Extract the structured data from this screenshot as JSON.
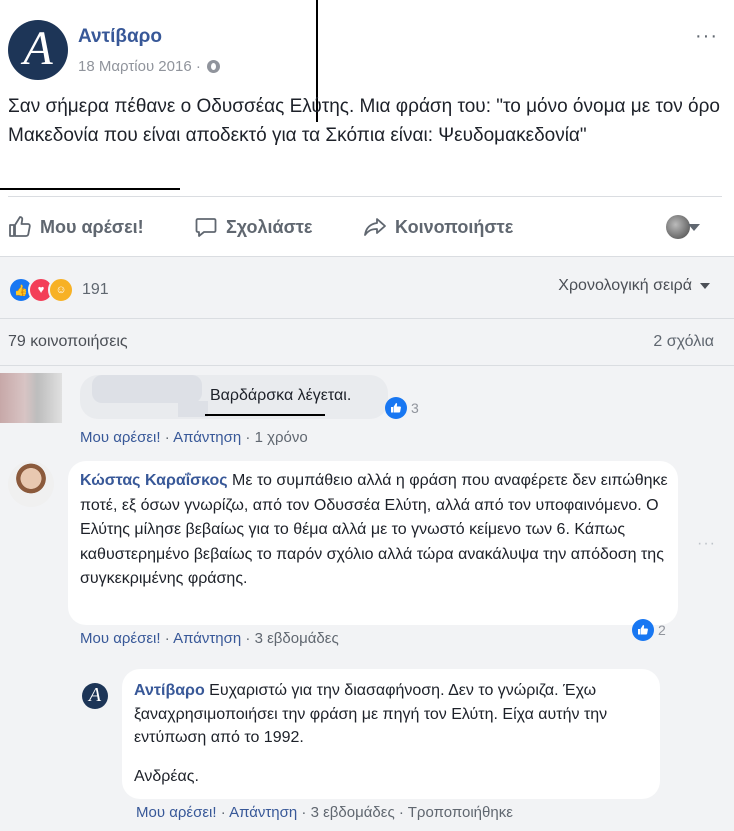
{
  "post": {
    "page_name": "Αντίβαρο",
    "avatar_letter": "A",
    "date": "18 Μαρτίου 2016 ·",
    "more": "···",
    "text": "Σαν σήμερα πέθανε ο Οδυσσέας Ελύτης. Μια φράση του: \"το μόνο όνομα με τον όρο Μακεδονία που είναι αποδεκτό για τα Σκόπια είναι: Ψευδομακεδονία\""
  },
  "actions": {
    "like": "Μου αρέσει!",
    "comment": "Σχολιάστε",
    "share": "Κοινοποιήστε"
  },
  "stats": {
    "reactions_count": "191",
    "sort_label": "Χρονολογική σειρά",
    "shares": "79 κοινοποιήσεις",
    "comments": "2 σχόλια"
  },
  "comments": [
    {
      "text": "Βαρδάρσκα λέγεται.",
      "likes": "3",
      "like_label": "Μου αρέσει!",
      "reply_label": "Απάντηση",
      "time": "1 χρόνο"
    },
    {
      "author": "Κώστας Καραΐσκος",
      "text": "Με το συμπάθειο αλλά η φράση που αναφέρετε δεν ειπώθηκε ποτέ, εξ όσων γνωρίζω, από τον Οδυσσέα Ελύτη, αλλά από τον υποφαινόμενο. Ο Ελύτης μίλησε βεβαίως για το θέμα αλλά με το γνωστό κείμενο των 6. Κάπως καθυστερημένο βεβαίως το παρόν σχόλιο αλλά τώρα ανακάλυψα την απόδοση της συγκεκριμένης φράσης.",
      "likes": "2",
      "like_label": "Μου αρέσει!",
      "reply_label": "Απάντηση",
      "time": "3 εβδομάδες",
      "more": "···"
    }
  ],
  "reply": {
    "author": "Αντίβαρο",
    "text": "Ευχαριστώ για την διασαφήνοση. Δεν το γνώριζα. Έχω ξαναχρησιμοποιήσει την φράση με πηγή τον Ελύτη. Είχα αυτήν την εντύπωση από το 1992.",
    "signature": "Ανδρέας.",
    "like_label": "Μου αρέσει!",
    "reply_label": "Απάντηση",
    "time": "3 εβδομάδες",
    "edited": "Τροποποιήθηκε",
    "avatar_letter": "A"
  },
  "colors": {
    "link": "#385898",
    "like_blue": "#1877f2",
    "love_red": "#f33e58",
    "haha_yellow": "#f7b125",
    "comments_bg": "#f2f3f5"
  }
}
